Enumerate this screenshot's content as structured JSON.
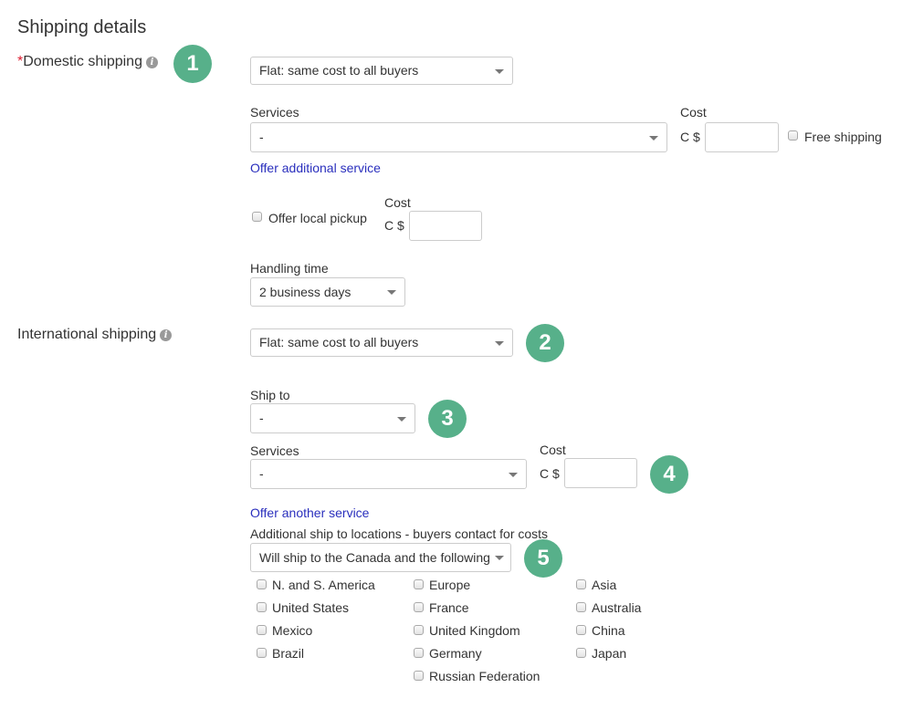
{
  "page": {
    "title": "Shipping details"
  },
  "domestic": {
    "required_marker": "*",
    "label": "Domestic shipping",
    "info_icon": "i",
    "badge": "1",
    "type_select": "Flat: same cost to all buyers",
    "services_label": "Services",
    "services_value": "-",
    "cost_label": "Cost",
    "currency": "C $",
    "cost_value": "",
    "free_shipping_label": "Free shipping",
    "free_shipping_checked": false,
    "offer_additional_link": "Offer additional service",
    "local_pickup_label": "Offer local pickup",
    "local_pickup_checked": false,
    "local_cost_label": "Cost",
    "local_currency": "C $",
    "local_cost_value": "",
    "handling_label": "Handling time",
    "handling_value": "2 business days"
  },
  "international": {
    "label": "International shipping",
    "info_icon": "i",
    "type_select": "Flat: same cost to all buyers",
    "badge_type": "2",
    "ship_to_label": "Ship to",
    "ship_to_value": "-",
    "badge_ship_to": "3",
    "services_label": "Services",
    "services_value": "-",
    "cost_label": "Cost",
    "currency": "C $",
    "cost_value": "",
    "badge_services": "4",
    "offer_another_link": "Offer another service",
    "additional_label": "Additional ship to locations - buyers contact for costs",
    "additional_value": "Will ship to the Canada and the following",
    "badge_additional": "5",
    "locations": {
      "col1": [
        {
          "label": "N. and S. America",
          "checked": false
        },
        {
          "label": "United States",
          "checked": false
        },
        {
          "label": "Mexico",
          "checked": false
        },
        {
          "label": "Brazil",
          "checked": false
        }
      ],
      "col2": [
        {
          "label": "Europe",
          "checked": false
        },
        {
          "label": "France",
          "checked": false
        },
        {
          "label": "United Kingdom",
          "checked": false
        },
        {
          "label": "Germany",
          "checked": false
        },
        {
          "label": "Russian Federation",
          "checked": false
        }
      ],
      "col3": [
        {
          "label": "Asia",
          "checked": false
        },
        {
          "label": "Australia",
          "checked": false
        },
        {
          "label": "China",
          "checked": false
        },
        {
          "label": "Japan",
          "checked": false
        }
      ]
    }
  },
  "colors": {
    "badge": "#57b08a",
    "link": "#2a2fbd",
    "required": "#dd1e31"
  }
}
